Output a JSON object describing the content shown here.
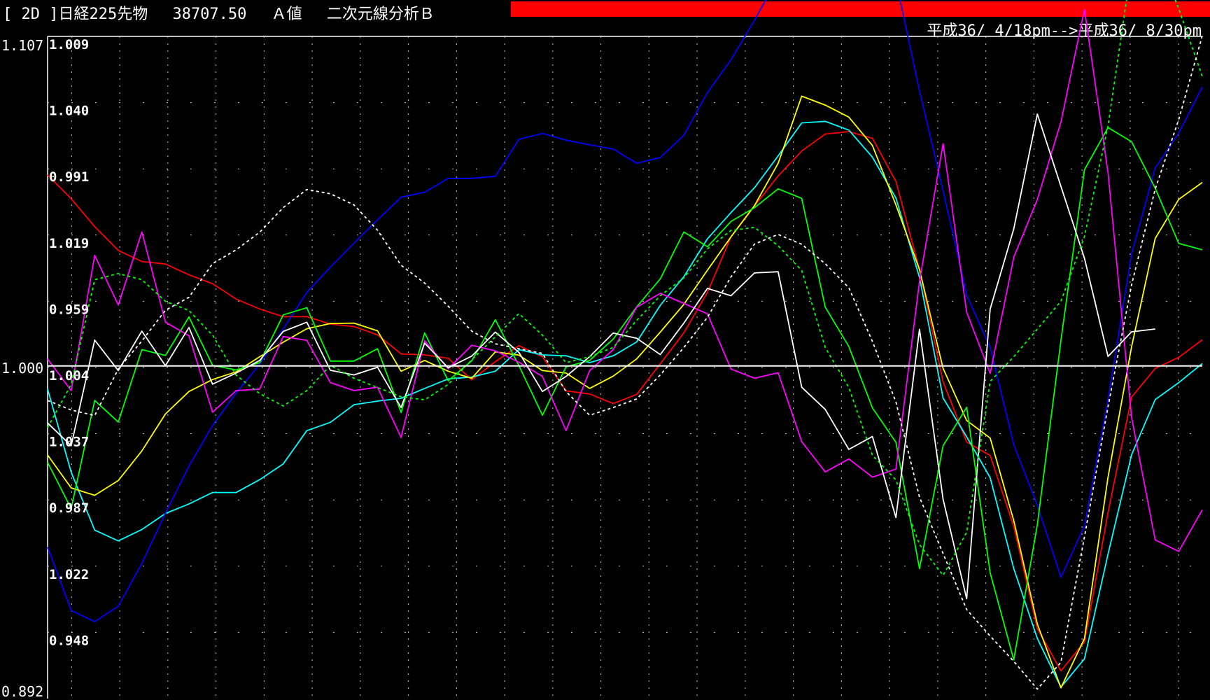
{
  "header": {
    "title": "[ 2D ]日経225先物　 38707.50　 Ａ値　 二次元線分析Ｂ",
    "date_range": "平成36/ 4/18pm-->平成36/ 8/30pm",
    "bar_color": "#ff0000"
  },
  "chart_data": {
    "type": "line",
    "y_axis": {
      "top_label": "1.107",
      "mid_label": "1.000",
      "bottom_label": "0.892",
      "ylim": [
        0.892,
        1.107
      ],
      "baseline": 1.0
    },
    "row_labels": [
      "1.009",
      "1.040",
      "0.991",
      "1.019",
      "0.959",
      "1.004",
      "1.037",
      "0.987",
      "1.022",
      "0.948"
    ],
    "grid": true,
    "x_count": 50,
    "series": [
      {
        "color": "#ff0000",
        "dashed": false,
        "values": [
          1.062,
          1.0543,
          1.0452,
          1.0375,
          1.0339,
          1.0331,
          1.0296,
          1.0267,
          1.0217,
          1.0185,
          1.016,
          1.016,
          1.0136,
          1.0128,
          1.0101,
          1.0039,
          1.0036,
          1.0025,
          0.9955,
          1.0014,
          1.0066,
          1.003,
          0.9919,
          0.9909,
          0.9878,
          0.9908,
          1.0007,
          1.0108,
          1.0239,
          1.0419,
          1.052,
          1.0617,
          1.0698,
          1.0753,
          1.0761,
          1.0739,
          1.0599,
          1.0312,
          0.9948,
          0.9753,
          0.9709,
          0.9478,
          0.9147,
          0.901,
          0.9104,
          0.9524,
          0.9899,
          0.9992,
          1.0028,
          1.0085
        ]
      },
      {
        "color": "#00ffff",
        "dashed": false,
        "values": [
          0.9925,
          0.9655,
          0.9467,
          0.9432,
          0.9469,
          0.9521,
          0.9552,
          0.9589,
          0.9589,
          0.9631,
          0.9682,
          0.979,
          0.9817,
          0.9874,
          0.9886,
          0.9895,
          0.9927,
          0.9958,
          0.9964,
          0.9983,
          1.0053,
          1.0036,
          1.0033,
          1.0011,
          1.0033,
          1.0078,
          1.0197,
          1.029,
          1.0413,
          1.0498,
          1.0579,
          1.0682,
          1.0789,
          1.0794,
          1.0766,
          1.0678,
          1.0545,
          1.0287,
          0.9896,
          0.977,
          0.9637,
          0.9342,
          0.9115,
          0.8957,
          0.9049,
          0.9389,
          0.9712,
          0.9891,
          0.9946,
          1.0008
        ]
      },
      {
        "color": "#0000ff",
        "dashed": false,
        "values": [
          0.9412,
          0.9206,
          0.917,
          0.922,
          0.9359,
          0.9522,
          0.9675,
          0.9807,
          0.9912,
          1.0006,
          1.012,
          1.0239,
          1.0321,
          1.0399,
          1.0474,
          1.0548,
          1.0564,
          1.0609,
          1.0609,
          1.0616,
          1.0736,
          1.0755,
          1.0733,
          1.0718,
          1.0704,
          1.0658,
          1.0677,
          1.0749,
          1.0888,
          1.0994,
          1.1123,
          1.1261,
          1.1425,
          1.1623,
          1.1564,
          1.1474,
          1.1252,
          1.0892,
          1.0569,
          1.023,
          1.0059,
          0.9744,
          0.9547,
          0.9314,
          0.9481,
          0.9892,
          1.0365,
          1.0643,
          1.0756,
          1.0906
        ]
      },
      {
        "color": "#ffff00",
        "dashed": false,
        "values": [
          0.9711,
          0.9604,
          0.958,
          0.9628,
          0.9724,
          0.9844,
          0.9917,
          0.9956,
          0.9981,
          1.003,
          1.0077,
          1.0121,
          1.0138,
          1.0139,
          1.0114,
          0.9983,
          1.0018,
          0.9983,
          0.996,
          1.0046,
          1.0035,
          0.9985,
          0.9977,
          0.9927,
          0.9967,
          1.0023,
          1.011,
          1.02,
          1.0311,
          1.0419,
          1.0521,
          1.0658,
          1.0876,
          1.0847,
          1.0808,
          1.0716,
          1.0523,
          1.0313,
          0.9992,
          0.9823,
          0.9766,
          0.9498,
          0.9162,
          0.8955,
          0.9115,
          0.9639,
          1.0063,
          1.0414,
          1.0541,
          1.0596
        ]
      },
      {
        "color": "#00ff00",
        "dashed": false,
        "values": [
          0.9687,
          0.9537,
          0.9888,
          0.9818,
          1.0053,
          1.0034,
          1.0159,
          1.0002,
          0.9987,
          1.0011,
          1.0166,
          1.0189,
          1.0016,
          1.0016,
          1.0056,
          0.9849,
          1.0107,
          0.9952,
          1.0017,
          1.015,
          1.0001,
          0.984,
          0.9997,
          1.0018,
          1.0087,
          1.0192,
          1.0283,
          1.0435,
          1.0387,
          1.0469,
          1.0514,
          1.0575,
          1.0544,
          1.0191,
          1.0063,
          0.9864,
          0.9752,
          0.9342,
          0.9741,
          0.9866,
          0.9328,
          0.9046,
          0.9485,
          1.0083,
          1.0637,
          1.0774,
          1.0728,
          1.0577,
          1.0398,
          1.0377
        ]
      },
      {
        "color": "#ff00ff",
        "dashed": false,
        "values": [
          1.0023,
          0.992,
          1.0359,
          1.0198,
          1.0435,
          1.0142,
          1.0098,
          0.985,
          0.992,
          0.9925,
          1.0096,
          1.0083,
          0.9946,
          0.992,
          0.9931,
          0.9768,
          1.0082,
          0.9991,
          1.0067,
          1.0049,
          1.0012,
          0.9966,
          0.979,
          0.9985,
          1.0053,
          1.0191,
          1.0236,
          1.0203,
          1.0169,
          0.999,
          0.996,
          0.9978,
          0.9754,
          0.9656,
          0.9698,
          0.9639,
          0.9665,
          1.0275,
          1.0722,
          1.0174,
          0.9976,
          1.0353,
          1.0541,
          1.0792,
          1.1158,
          1.0627,
          0.9832,
          0.9435,
          0.9398,
          0.9533
        ]
      },
      {
        "color": "#ffffff",
        "dashed": false,
        "values": [
          0.9815,
          0.9741,
          1.0084,
          0.9985,
          1.0113,
          1.0001,
          1.0125,
          0.9941,
          0.9977,
          1.0018,
          1.0112,
          1.0142,
          0.9986,
          0.9971,
          0.9996,
          0.9865,
          1.0074,
          0.9994,
          1.0032,
          1.011,
          1.0044,
          0.9917,
          0.9966,
          1.003,
          1.0107,
          1.009,
          1.0037,
          1.0139,
          1.0252,
          1.0228,
          1.0302,
          1.0306,
          0.9931,
          0.9859,
          0.9729,
          0.9771,
          0.9508,
          1.0119,
          0.9567,
          0.9244,
          1.0185,
          1.0445,
          1.0818,
          1.0583,
          1.035,
          1.0031,
          1.0111,
          1.012
        ]
      },
      {
        "color": "#00ff00",
        "dashed": true,
        "values": [
          0.98,
          0.994,
          1.028,
          1.03,
          1.028,
          1.021,
          1.018,
          1.01,
          0.997,
          0.991,
          0.987,
          0.992,
          1.0002,
          0.996,
          0.993,
          0.99,
          0.989,
          0.994,
          1.002,
          1.0095,
          1.017,
          1.01,
          1.0011,
          1.003,
          1.006,
          1.0148,
          1.0228,
          1.0286,
          1.038,
          1.044,
          1.045,
          1.039,
          1.031,
          1.006,
          0.993,
          0.971,
          0.963,
          0.942,
          0.932,
          0.946,
          0.995,
          1.003,
          1.012,
          1.021,
          1.042,
          1.078,
          1.13,
          1.135,
          1.116,
          1.094
        ]
      },
      {
        "color": "#ffffff",
        "dashed": true,
        "values": [
          0.9888,
          0.9857,
          0.9839,
          0.999,
          1.0081,
          1.0181,
          1.0223,
          1.0332,
          1.0377,
          1.0434,
          1.0514,
          1.0573,
          1.0559,
          1.0523,
          1.0441,
          1.0327,
          1.0269,
          1.0194,
          1.0113,
          1.0072,
          1.0056,
          1.0041,
          0.9917,
          0.984,
          0.9865,
          0.9893,
          0.9971,
          1.006,
          1.0158,
          1.0289,
          1.0396,
          1.0427,
          1.0395,
          1.0332,
          1.0254,
          1.008,
          0.9883,
          0.9574,
          0.9391,
          0.9209,
          0.9123,
          0.9041,
          0.8951,
          0.9038,
          0.9445,
          0.9868,
          1.0264,
          1.0574,
          1.08,
          1.1072
        ]
      }
    ]
  }
}
